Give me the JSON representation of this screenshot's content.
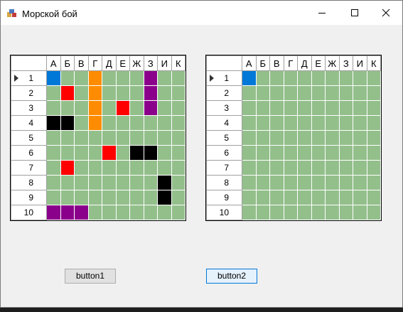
{
  "window": {
    "title": "Морской бой"
  },
  "columns": [
    "А",
    "Б",
    "В",
    "Г",
    "Д",
    "Е",
    "Ж",
    "З",
    "И",
    "К"
  ],
  "rows": [
    "1",
    "2",
    "3",
    "4",
    "5",
    "6",
    "7",
    "8",
    "9",
    "10"
  ],
  "colors": {
    "water": "#93bf8b",
    "blue": "#0078d7",
    "red": "#ff0000",
    "orange": "#ff8c00",
    "purple": "#8b008b",
    "black": "#000000"
  },
  "grid1": {
    "selected_row": 1,
    "cells": [
      [
        "blue",
        null,
        null,
        "orange",
        null,
        null,
        null,
        "purple",
        null,
        null
      ],
      [
        null,
        "red",
        null,
        "orange",
        null,
        null,
        null,
        "purple",
        null,
        null
      ],
      [
        null,
        null,
        null,
        "orange",
        null,
        "red",
        null,
        "purple",
        null,
        null
      ],
      [
        "black",
        "black",
        null,
        "orange",
        null,
        null,
        null,
        null,
        null,
        null
      ],
      [
        null,
        null,
        null,
        null,
        null,
        null,
        null,
        null,
        null,
        null
      ],
      [
        null,
        null,
        null,
        null,
        "red",
        null,
        "black",
        "black",
        null,
        null
      ],
      [
        null,
        "red",
        null,
        null,
        null,
        null,
        null,
        null,
        null,
        null
      ],
      [
        null,
        null,
        null,
        null,
        null,
        null,
        null,
        null,
        "black",
        null
      ],
      [
        null,
        null,
        null,
        null,
        null,
        null,
        null,
        null,
        "black",
        null
      ],
      [
        "purple",
        "purple",
        "purple",
        null,
        null,
        null,
        null,
        null,
        null,
        null
      ]
    ]
  },
  "grid2": {
    "selected_row": 1,
    "cells": [
      [
        "blue",
        null,
        null,
        null,
        null,
        null,
        null,
        null,
        null,
        null
      ],
      [
        null,
        null,
        null,
        null,
        null,
        null,
        null,
        null,
        null,
        null
      ],
      [
        null,
        null,
        null,
        null,
        null,
        null,
        null,
        null,
        null,
        null
      ],
      [
        null,
        null,
        null,
        null,
        null,
        null,
        null,
        null,
        null,
        null
      ],
      [
        null,
        null,
        null,
        null,
        null,
        null,
        null,
        null,
        null,
        null
      ],
      [
        null,
        null,
        null,
        null,
        null,
        null,
        null,
        null,
        null,
        null
      ],
      [
        null,
        null,
        null,
        null,
        null,
        null,
        null,
        null,
        null,
        null
      ],
      [
        null,
        null,
        null,
        null,
        null,
        null,
        null,
        null,
        null,
        null
      ],
      [
        null,
        null,
        null,
        null,
        null,
        null,
        null,
        null,
        null,
        null
      ],
      [
        null,
        null,
        null,
        null,
        null,
        null,
        null,
        null,
        null,
        null
      ]
    ]
  },
  "buttons": {
    "button1": "button1",
    "button2": "button2"
  }
}
